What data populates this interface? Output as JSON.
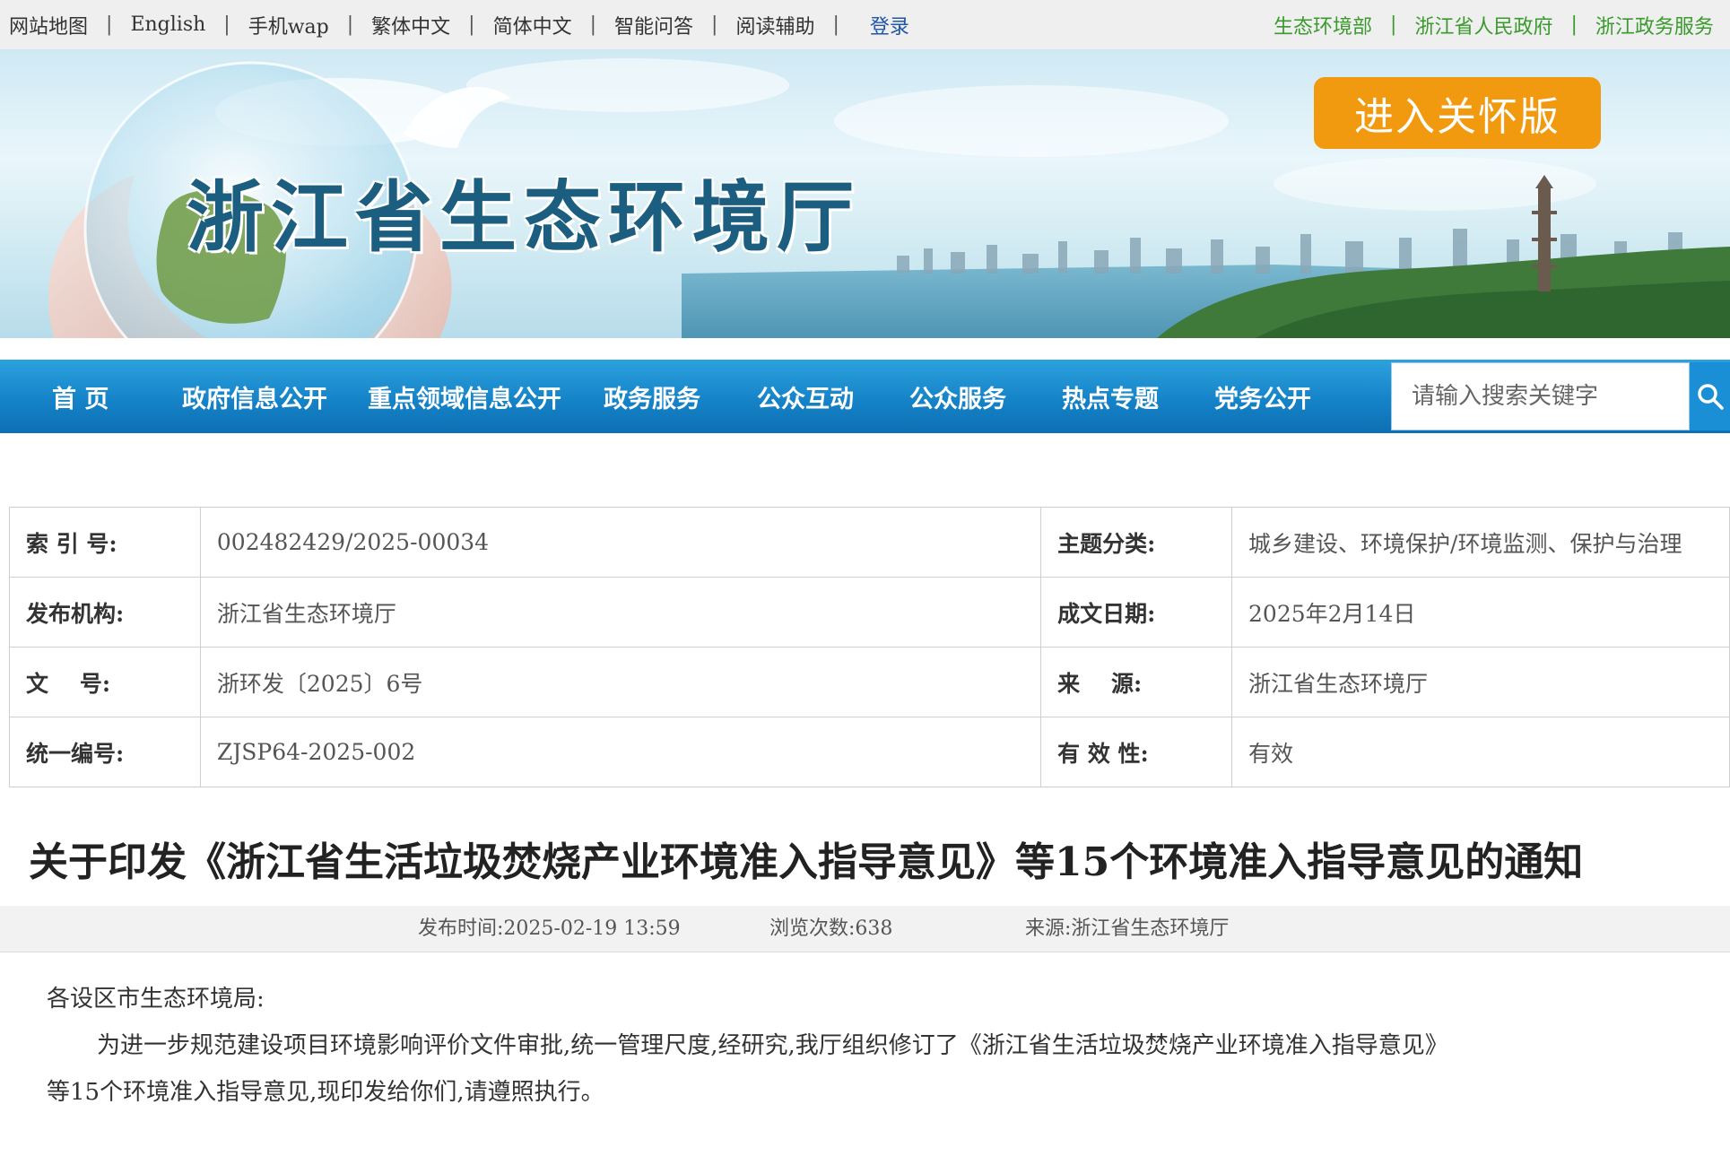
{
  "topbar": {
    "left_links": [
      "网站地图",
      "English",
      "手机wap",
      "繁体中文",
      "简体中文",
      "智能问答",
      "阅读辅助"
    ],
    "login": "登录",
    "right_links": [
      "生态环境部",
      "浙江省人民政府",
      "浙江政务服务"
    ]
  },
  "banner": {
    "site_title": "浙江省生态环境厅",
    "care_button": "进入关怀版"
  },
  "nav": {
    "items": [
      "首  页",
      "政府信息公开",
      "重点领域信息公开",
      "政务服务",
      "公众互动",
      "公众服务",
      "热点专题",
      "党务公开"
    ],
    "search_placeholder": "请输入搜索关键字"
  },
  "meta": {
    "rows": [
      {
        "l1": "索 引 号:",
        "v1": "002482429/2025-00034",
        "l2": "主题分类:",
        "v2": "城乡建设、环境保护/环境监测、保护与治理"
      },
      {
        "l1": "发布机构:",
        "v1": "浙江省生态环境厅",
        "l2": "成文日期:",
        "v2": "2025年2月14日"
      },
      {
        "l1": "文    号:",
        "v1": "浙环发〔2025〕6号",
        "l2": "来    源:",
        "v2": "浙江省生态环境厅"
      },
      {
        "l1": "统一编号:",
        "v1": "ZJSP64-2025-002",
        "l2": "有 效 性:",
        "v2": "有效"
      }
    ]
  },
  "article": {
    "title": "关于印发《浙江省生活垃圾焚烧产业环境准入指导意见》等15个环境准入指导意见的通知",
    "publish_time": "发布时间:2025-02-19 13:59",
    "views": "浏览次数:638",
    "source": "来源:浙江省生态环境厅",
    "salutation": "各设区市生态环境局:",
    "para_line1": "为进一步规范建设项目环境影响评价文件审批,统一管理尺度,经研究,我厅组织修订了《浙江省生活垃圾焚烧产业环境准入指导意见》",
    "para_line2": "等15个环境准入指导意见,现印发给你们,请遵照执行。"
  },
  "colors": {
    "nav_blue": "#1583c8",
    "care_orange": "#f29a0f",
    "gov_green": "#3a9a2c",
    "title_teal": "#1c5e7f"
  }
}
